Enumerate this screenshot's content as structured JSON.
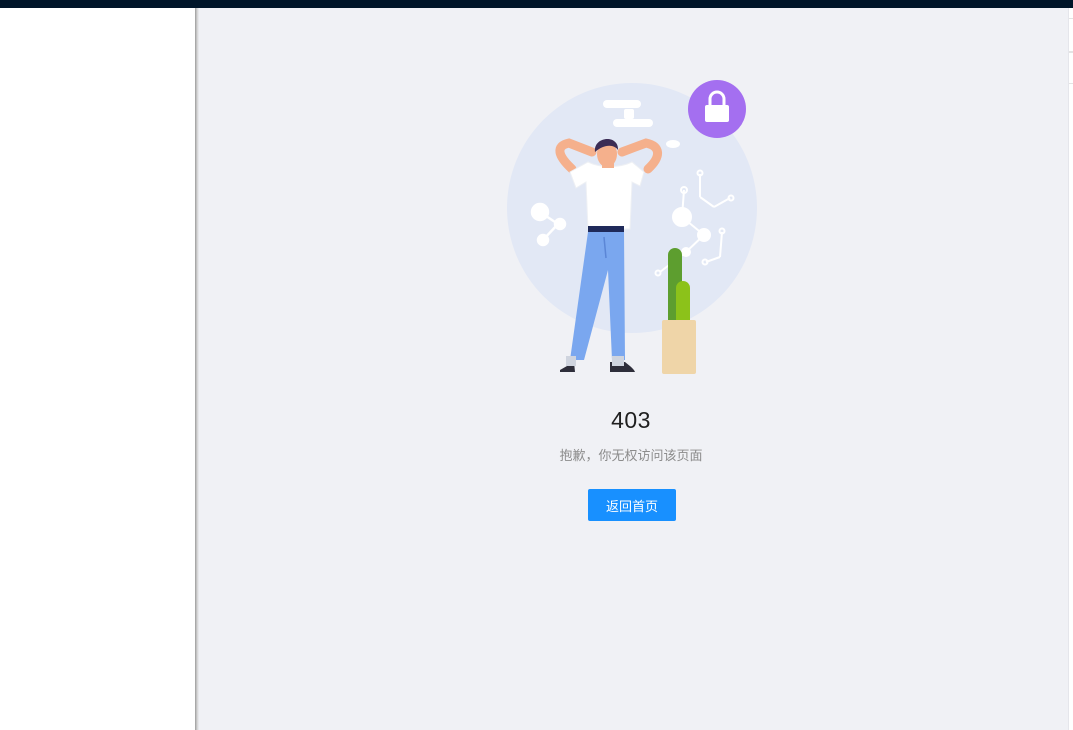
{
  "result": {
    "status": "403",
    "subtitle": "抱歉，你无权访问该页面",
    "back_button_label": "返回首页"
  },
  "icons": {
    "lock": "lock-icon",
    "illustration": "frustrated-person-with-cactus"
  },
  "colors": {
    "header": "#001529",
    "content_bg": "#f0f1f5",
    "primary": "#1890ff",
    "lock_badge": "#a46ff0"
  }
}
